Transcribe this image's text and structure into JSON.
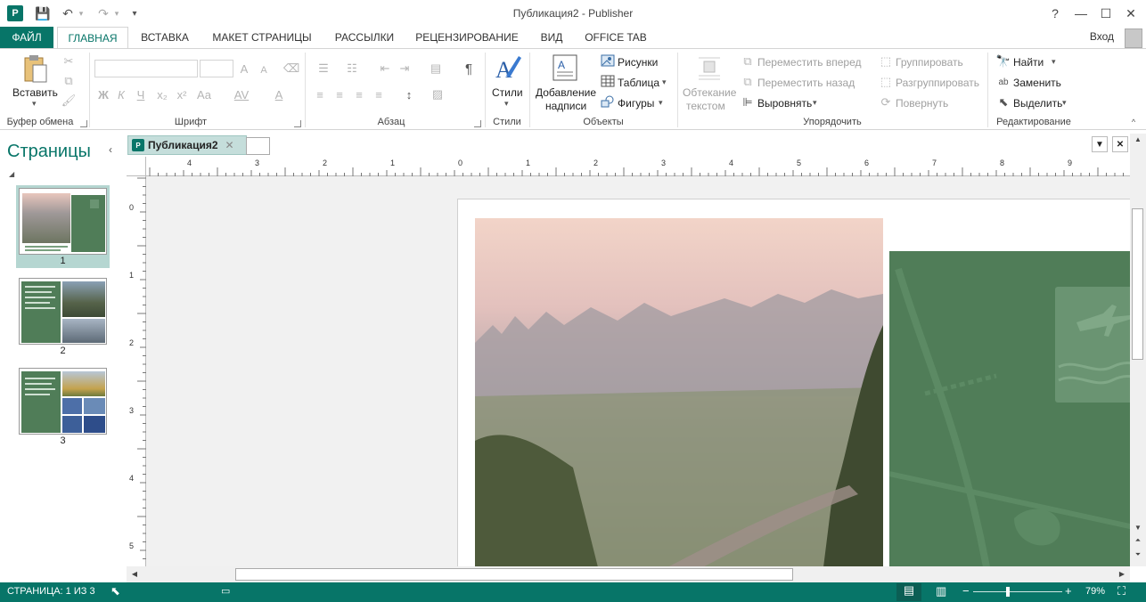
{
  "window": {
    "title": "Публикация2 - Publisher",
    "app_icon_letter": "P",
    "help": "?",
    "minimize": "—",
    "maximize": "☐",
    "close": "✕"
  },
  "qat": {
    "save": "💾",
    "undo": "↶",
    "redo": "↷",
    "customize": "▾"
  },
  "tabs": {
    "file": "ФАЙЛ",
    "items": [
      "ГЛАВНАЯ",
      "ВСТАВКА",
      "МАКЕТ СТРАНИЦЫ",
      "РАССЫЛКИ",
      "РЕЦЕНЗИРОВАНИЕ",
      "ВИД",
      "OFFICE TAB"
    ],
    "signin": "Вход"
  },
  "ribbon": {
    "groups": {
      "clipboard": "Буфер обмена",
      "font": "Шрифт",
      "paragraph": "Абзац",
      "styles": "Стили",
      "objects": "Объекты",
      "arrange": "Упорядочить",
      "editing": "Редактирование"
    },
    "clipboard": {
      "paste": "Вставить"
    },
    "font": {
      "bold": "Ж",
      "italic": "К",
      "underline": "Ч",
      "subscript": "x₂",
      "superscript": "x²",
      "case": "Aa",
      "spacing": "AV",
      "color": "A",
      "grow": "A",
      "shrink": "A"
    },
    "paragraph": {
      "pilcrow": "¶"
    },
    "styles": {
      "styles": "Стили"
    },
    "objects": {
      "textbox_line1": "Добавление",
      "textbox_line2": "надписи",
      "pictures": "Рисунки",
      "table": "Таблица",
      "shapes": "Фигуры"
    },
    "arrange": {
      "wrap_line1": "Обтекание",
      "wrap_line2": "текстом",
      "bring_forward": "Переместить вперед",
      "send_backward": "Переместить назад",
      "align": "Выровнять",
      "group": "Группировать",
      "ungroup": "Разгруппировать",
      "rotate": "Повернуть"
    },
    "editing": {
      "find": "Найти",
      "replace": "Заменить",
      "select": "Выделить"
    }
  },
  "pages_pane": {
    "title": "Страницы",
    "pages": [
      {
        "num": "1"
      },
      {
        "num": "2"
      },
      {
        "num": "3"
      }
    ]
  },
  "document": {
    "tab_name": "Публикация2",
    "tab_close": "✕",
    "dropdown": "▼",
    "close": "✕"
  },
  "ruler": {
    "h_labels": [
      "4",
      "3",
      "2",
      "1",
      "0",
      "1",
      "2",
      "3",
      "4",
      "5",
      "6",
      "7",
      "8",
      "9"
    ],
    "v_labels": [
      "0",
      "1",
      "2",
      "3",
      "4",
      "5"
    ]
  },
  "status": {
    "page_info": "СТРАНИЦА: 1 ИЗ 3",
    "zoom": "79%",
    "zoom_minus": "−",
    "zoom_plus": "+"
  },
  "colors": {
    "accent": "#077568",
    "green_panel": "#507d58",
    "page_thumb_selected": "#b5d6d1"
  }
}
